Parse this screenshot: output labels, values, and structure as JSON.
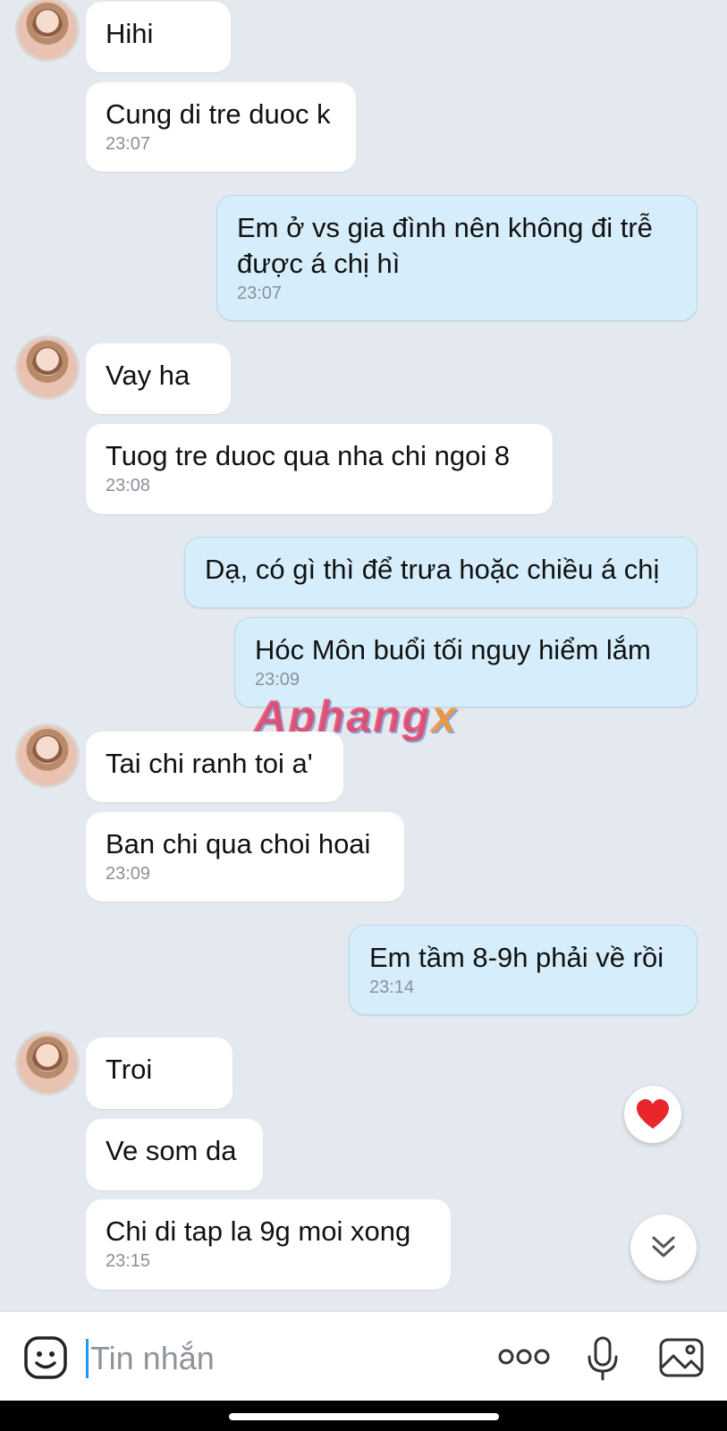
{
  "messages": [
    {
      "text": "Hihi",
      "time": ""
    },
    {
      "text": "Cung di tre duoc k",
      "time": "23:07"
    },
    {
      "text": "Em ở vs gia đình nên không đi trễ được á chị hì",
      "time": "23:07"
    },
    {
      "text": "Vay ha",
      "time": ""
    },
    {
      "text": "Tuog tre duoc qua nha chi ngoi 8",
      "time": "23:08"
    },
    {
      "text": "Dạ, có gì thì để trưa hoặc chiều á chị",
      "time": ""
    },
    {
      "text": "Hóc Môn buổi tối nguy hiểm lắm",
      "time": "23:09"
    },
    {
      "text": "Tai chi ranh toi a'",
      "time": ""
    },
    {
      "text": "Ban chi qua choi hoai",
      "time": "23:09"
    },
    {
      "text": "Em tầm 8-9h phải về rồi",
      "time": "23:14"
    },
    {
      "text": "Troi",
      "time": ""
    },
    {
      "text": "Ve som da",
      "time": ""
    },
    {
      "text": "Chi di tap la 9g moi xong",
      "time": "23:15"
    }
  ],
  "watermark": {
    "main": "Aphang",
    "accent": "x"
  },
  "composer": {
    "placeholder": "Tin nhắn"
  },
  "icons": {
    "emoji": "emoji-icon",
    "more": "more-icon",
    "mic": "microphone-icon",
    "image": "image-icon",
    "heart": "heart-icon",
    "scroll": "double-chevron-down-icon"
  },
  "colors": {
    "incoming_bubble": "#ffffff",
    "outgoing_bubble": "#d6eefb",
    "background": "#e4e9f0",
    "heart": "#e8262b"
  }
}
